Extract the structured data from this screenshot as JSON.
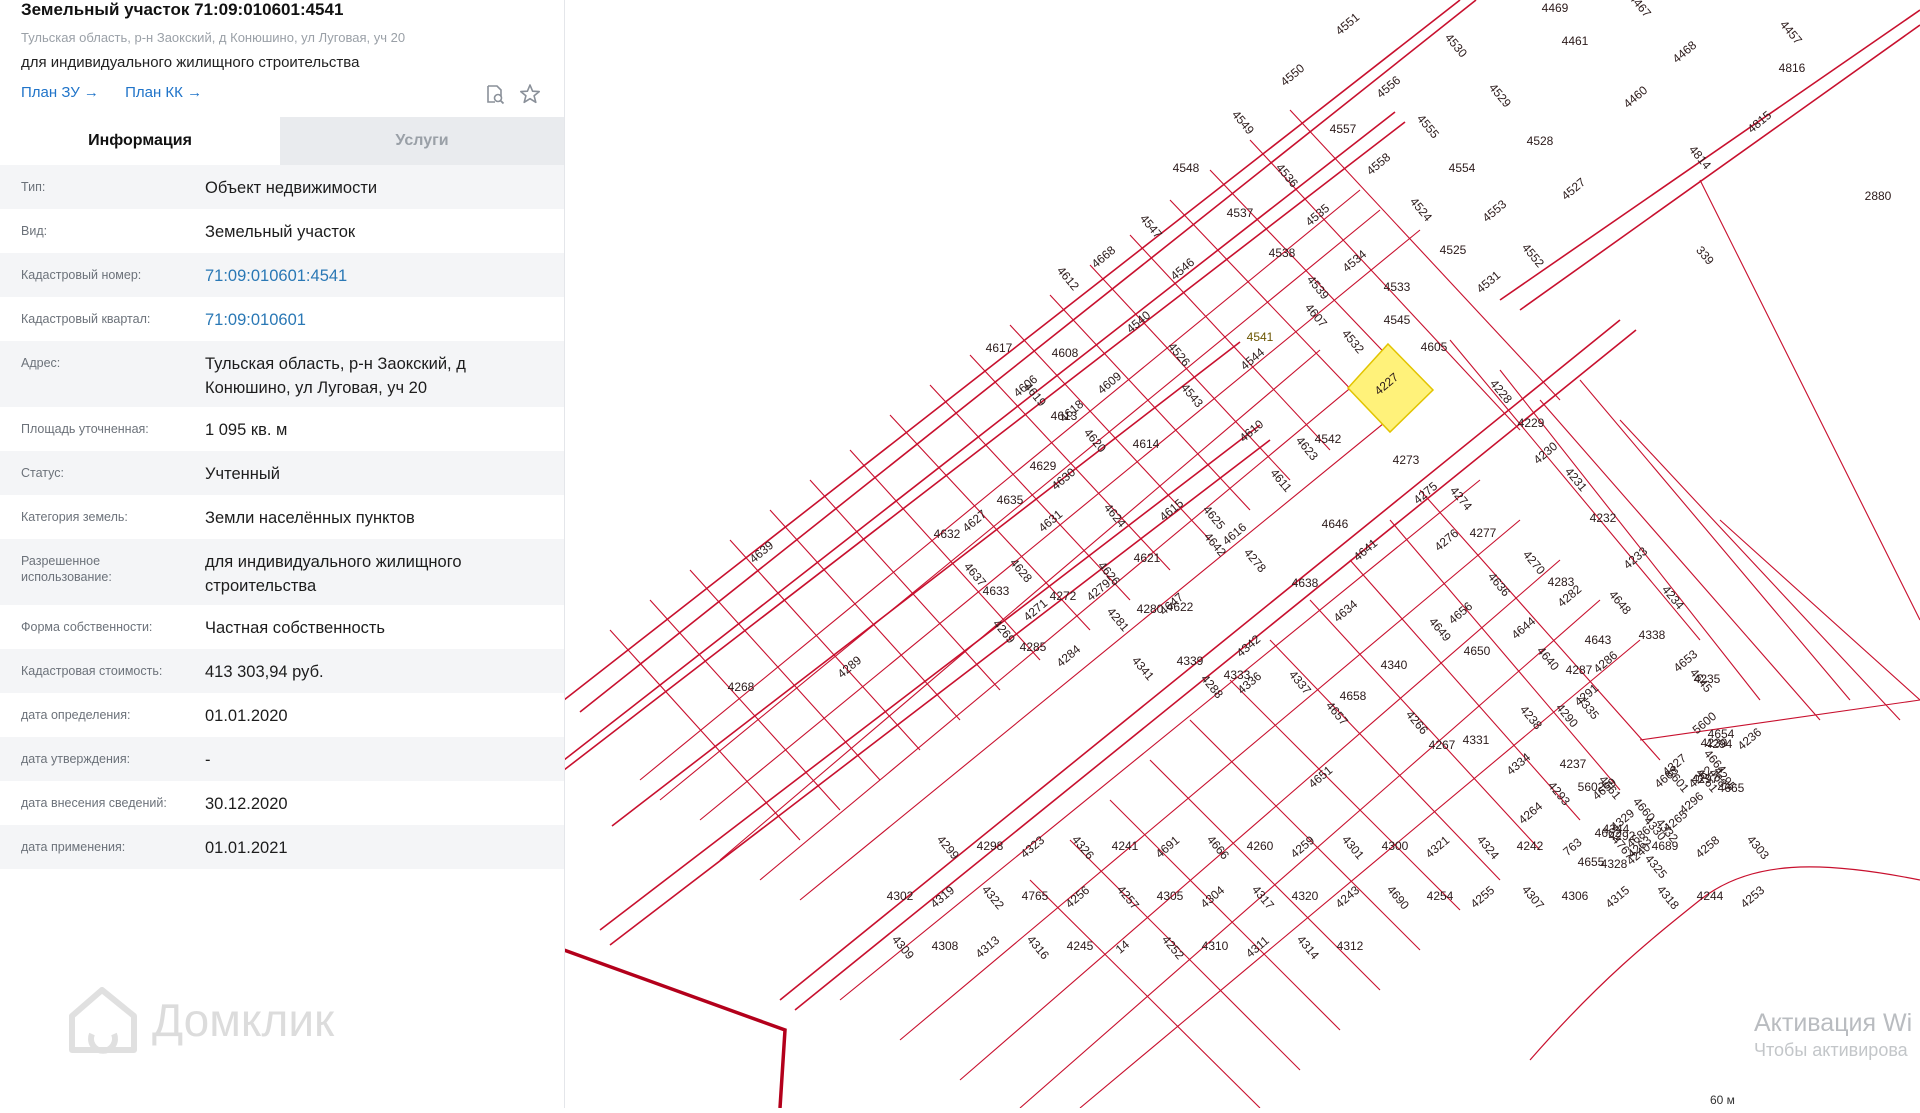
{
  "card": {
    "title": "Земельный участок 71:09:010601:4541",
    "address_sub": "Тульская область, р-н Заокский, д Конюшино, ул Луговая, уч 20",
    "purpose": "для индивидуального жилищного строительства",
    "link_plan_zu": "План ЗУ →",
    "link_plan_kk": "План КК →",
    "icons": [
      "document-search-icon",
      "star-icon"
    ]
  },
  "tabs": [
    {
      "label": "Информация",
      "active": true
    },
    {
      "label": "Услуги",
      "active": false
    }
  ],
  "rows": [
    {
      "label": "Тип:",
      "value": "Объект недвижимости",
      "link": false
    },
    {
      "label": "Вид:",
      "value": "Земельный участок",
      "link": false
    },
    {
      "label": "Кадастровый номер:",
      "value": "71:09:010601:4541",
      "link": true
    },
    {
      "label": "Кадастровый квартал:",
      "value": "71:09:010601",
      "link": true
    },
    {
      "label": "Адрес:",
      "value": "Тульская область, р-н Заокский, д Конюшино, ул Луговая, уч 20",
      "link": false
    },
    {
      "label": "Площадь уточненная:",
      "value": "1 095 кв. м",
      "link": false
    },
    {
      "label": "Статус:",
      "value": "Учтенный",
      "link": false
    },
    {
      "label": "Категория земель:",
      "value": "Земли населённых пунктов",
      "link": false
    },
    {
      "label": "Разрешенное использование:",
      "value": "для индивидуального жилищного строительства",
      "link": false
    },
    {
      "label": "Форма собственности:",
      "value": "Частная собственность",
      "link": false
    },
    {
      "label": "Кадастровая стоимость:",
      "value": "413 303,94 руб.",
      "link": false
    },
    {
      "label": "дата определения:",
      "value": "01.01.2020",
      "link": false
    },
    {
      "label": "дата утверждения:",
      "value": "-",
      "link": false
    },
    {
      "label": "дата внесения сведений:",
      "value": "30.12.2020",
      "link": false
    },
    {
      "label": "дата применения:",
      "value": "01.01.2021",
      "link": false
    }
  ],
  "logo_text": "Домклик",
  "map": {
    "selected_parcel": "4541",
    "line_color": "#c8102e",
    "highlight_color": "#fff27a",
    "parcels": [
      "4551",
      "4530",
      "4469",
      "4468",
      "4467",
      "4461",
      "4460",
      "4457",
      "4816",
      "4815",
      "4814",
      "2880",
      "4550",
      "4529",
      "4528",
      "4527",
      "4549",
      "4557",
      "4556",
      "4555",
      "4554",
      "4553",
      "4552",
      "4548",
      "4558",
      "4524",
      "4525",
      "4531",
      "4536",
      "4537",
      "4535",
      "4547",
      "4538",
      "4534",
      "4539",
      "4533",
      "4546",
      "4607",
      "4545",
      "4540",
      "4532",
      "4605",
      "4668",
      "4612",
      "4608",
      "4544",
      "4526",
      "4541",
      "4227",
      "4228",
      "4229",
      "4230",
      "4231",
      "4232",
      "4233",
      "4234",
      "4235",
      "4236",
      "339",
      "4617",
      "4606",
      "4619",
      "4613",
      "4609",
      "4543",
      "4542",
      "4618",
      "4620",
      "4614",
      "4610",
      "4611",
      "4629",
      "4630",
      "4624",
      "4621",
      "4615",
      "4625",
      "4635",
      "4631",
      "4626",
      "4622",
      "4616",
      "4623",
      "4273",
      "4275",
      "4274",
      "4277",
      "4276",
      "4636",
      "4632",
      "4627",
      "4628",
      "4272",
      "4279",
      "4278",
      "4646",
      "4641",
      "4637",
      "4633",
      "4271",
      "4281",
      "4280",
      "4647",
      "4642",
      "4638",
      "4634",
      "4270",
      "4283",
      "4282",
      "4648",
      "4643",
      "4639",
      "4269",
      "4285",
      "4284",
      "4341",
      "4339",
      "4342",
      "4337",
      "4340",
      "4656",
      "4649",
      "4650",
      "4644",
      "4640",
      "4287",
      "4286",
      "4335",
      "4338",
      "4653",
      "4645",
      "4268",
      "4289",
      "4288",
      "4333",
      "4336",
      "4657",
      "4658",
      "4651",
      "4266",
      "4267",
      "4291",
      "4290",
      "4331",
      "4334",
      "4238",
      "4237",
      "4659",
      "4660",
      "4654",
      "5600",
      "5601",
      "5602",
      "4264",
      "4293",
      "4292",
      "4329",
      "4332",
      "4239",
      "4663",
      "4661",
      "4655",
      "4265",
      "4295",
      "4294",
      "4327",
      "4330",
      "4344",
      "4686",
      "4664",
      "4662",
      "4263",
      "4261",
      "4297",
      "4296",
      "4325",
      "4328",
      "4240",
      "4687",
      "4665",
      "4262",
      "4299",
      "4298",
      "4323",
      "4326",
      "4241",
      "4691",
      "4666",
      "4260",
      "4259",
      "4301",
      "4300",
      "4321",
      "4324",
      "4242",
      "763",
      "4767",
      "4689",
      "4258",
      "4303",
      "4302",
      "4319",
      "4322",
      "4765",
      "4256",
      "4257",
      "4305",
      "4304",
      "4317",
      "4320",
      "4243",
      "4690",
      "4254",
      "4255",
      "4307",
      "4306",
      "4315",
      "4318",
      "4244",
      "4253",
      "4309",
      "4308",
      "4313",
      "4316",
      "4245",
      "14",
      "4252",
      "4310",
      "4311",
      "4314",
      "4312"
    ]
  },
  "watermark": {
    "line1": "Активация Wi",
    "line2": "Чтобы активирова"
  },
  "scale_label": "60 м"
}
